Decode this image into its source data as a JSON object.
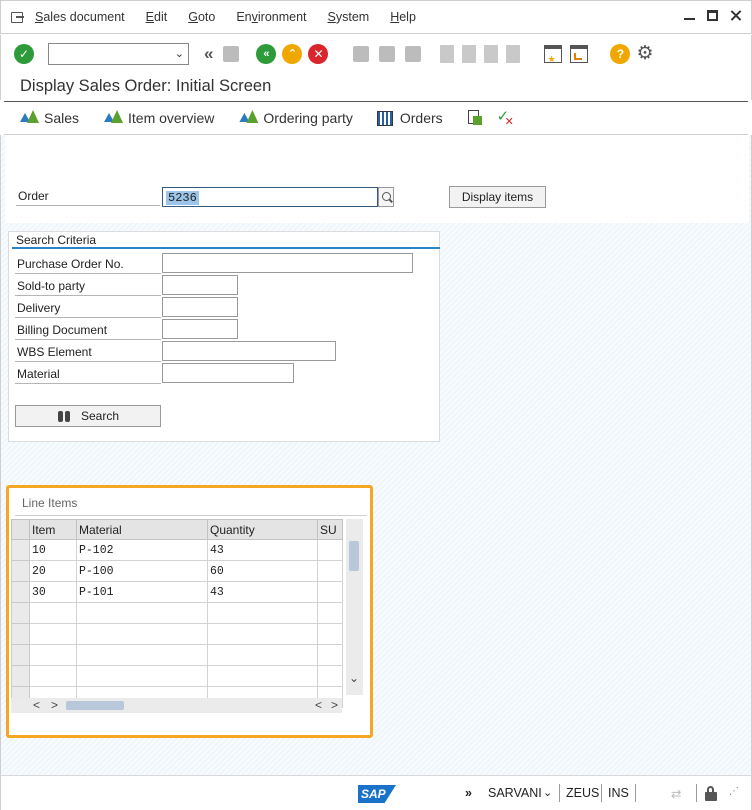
{
  "menubar": {
    "items": [
      {
        "pre": "",
        "u": "S",
        "post": "ales document"
      },
      {
        "pre": "",
        "u": "E",
        "post": "dit"
      },
      {
        "pre": "",
        "u": "G",
        "post": "oto"
      },
      {
        "pre": "En",
        "u": "v",
        "post": "ironment"
      },
      {
        "pre": "",
        "u": "S",
        "post": "ystem"
      },
      {
        "pre": "",
        "u": "H",
        "post": "elp"
      }
    ]
  },
  "toolbar": {
    "command_field_value": "",
    "icons": [
      "enter-icon",
      "back-icon",
      "exit-icon",
      "cancel-icon",
      "save-icon",
      "print-icon",
      "find-icon",
      "find-next-icon",
      "first-page-icon",
      "previous-page-icon",
      "next-page-icon",
      "last-page-icon",
      "create-session-icon",
      "shortcut-icon",
      "help-icon",
      "settings-icon"
    ],
    "colors": {
      "enter": "#2e9b3a",
      "back": "#2e9b3a",
      "exit": "#f0a800",
      "cancel": "#d9252b",
      "help": "#f0a800"
    }
  },
  "title": "Display Sales Order: Initial Screen",
  "app_toolbar": {
    "sales": "Sales",
    "item_overview": "Item overview",
    "ordering_party": "Ordering party",
    "orders": "Orders"
  },
  "order": {
    "label": "Order",
    "value": "5236",
    "display_items_button": "Display items"
  },
  "search_criteria": {
    "title": "Search Criteria",
    "fields": [
      {
        "label": "Purchase Order No.",
        "value": ""
      },
      {
        "label": "Sold-to party",
        "value": ""
      },
      {
        "label": "Delivery",
        "value": ""
      },
      {
        "label": "Billing Document",
        "value": ""
      },
      {
        "label": "WBS Element",
        "value": ""
      },
      {
        "label": "Material",
        "value": ""
      }
    ],
    "search_button": "Search"
  },
  "line_items": {
    "title": "Line Items",
    "columns": [
      "Item",
      "Material",
      "Quantity",
      "SU"
    ],
    "rows": [
      [
        "10",
        "P-102",
        "43",
        ""
      ],
      [
        "20",
        "P-100",
        "60",
        ""
      ],
      [
        "30",
        "P-101",
        "43",
        ""
      ]
    ],
    "highlight_color": "#f5a623"
  },
  "statusbar": {
    "system": "SARVANI",
    "server": "ZEUS",
    "mode": "INS",
    "logo": "SAP"
  }
}
